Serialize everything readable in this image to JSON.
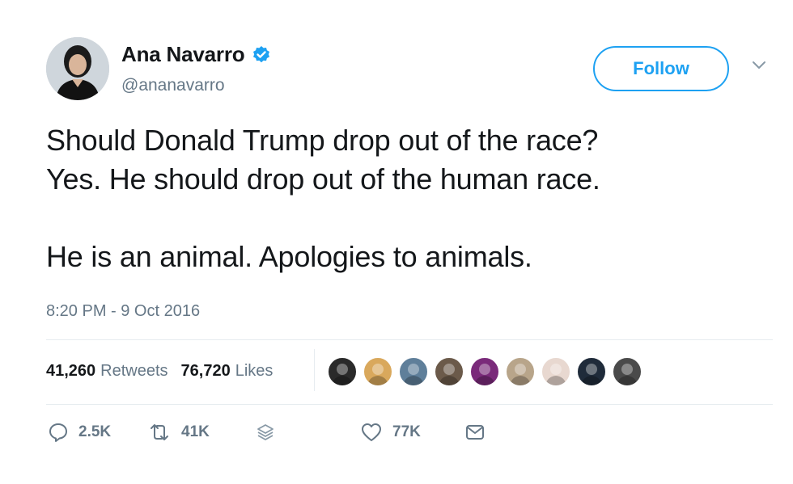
{
  "user": {
    "display_name": "Ana Navarro",
    "handle": "@ananavarro",
    "verified_icon": "verified-badge-icon",
    "avatar_icon": "avatar"
  },
  "follow_button": {
    "label": "Follow"
  },
  "menu": {
    "icon": "chevron-down-icon"
  },
  "tweet": {
    "text": "Should Donald Trump drop out of the race?\nYes. He should drop out of the human race.\n\nHe is an animal. Apologies to animals.",
    "timestamp": "8:20 PM - 9 Oct 2016"
  },
  "stats": {
    "retweets_count": "41,260",
    "retweets_label": "Retweets",
    "likes_count": "76,720",
    "likes_label": "Likes"
  },
  "likers": [
    {
      "color": "#2a2a2a"
    },
    {
      "color": "#d9a85c"
    },
    {
      "color": "#5f7f9a"
    },
    {
      "color": "#6b5a4a"
    },
    {
      "color": "#7a2a7a"
    },
    {
      "color": "#b8a58a"
    },
    {
      "color": "#e8d8d0"
    },
    {
      "color": "#1f2b3a"
    },
    {
      "color": "#4a4a4a"
    }
  ],
  "actions": {
    "reply_count": "2.5K",
    "retweet_count": "41K",
    "like_count": "77K",
    "reply_icon": "reply-icon",
    "retweet_icon": "retweet-icon",
    "stack_icon": "stack-icon",
    "like_icon": "heart-icon",
    "dm_icon": "envelope-icon"
  },
  "colors": {
    "accent": "#1da1f2",
    "text": "#14171a",
    "muted": "#657786",
    "divider": "#e6ecf0"
  }
}
